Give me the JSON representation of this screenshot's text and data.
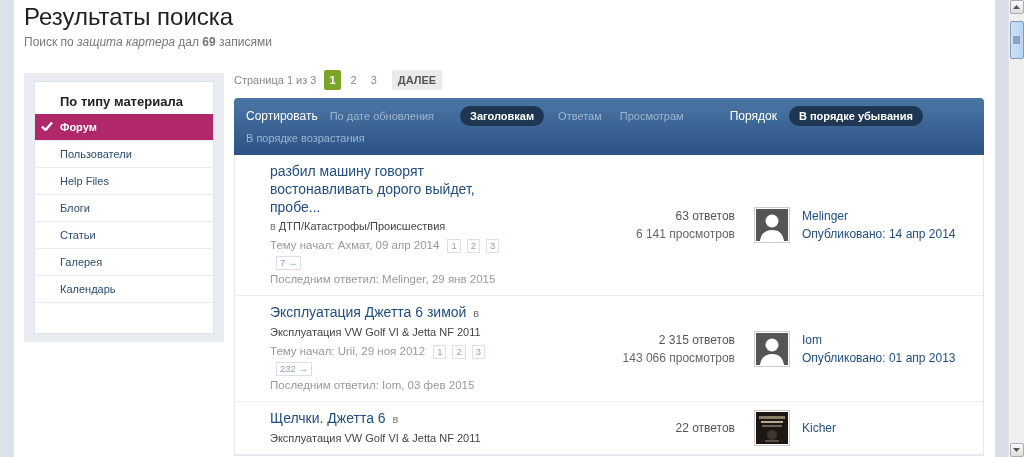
{
  "page": {
    "title": "Результаты поиска",
    "summary": "Поиск по *защита картера* дал **69** записями"
  },
  "sidebar": {
    "title": "По типу материала",
    "items": [
      {
        "label": "Форум",
        "selected": true
      },
      {
        "label": "Пользователи",
        "selected": false
      },
      {
        "label": "Help Files",
        "selected": false
      },
      {
        "label": "Блоги",
        "selected": false
      },
      {
        "label": "Статьи",
        "selected": false
      },
      {
        "label": "Галерея",
        "selected": false
      },
      {
        "label": "Календарь",
        "selected": false
      }
    ]
  },
  "pagination": {
    "label": "Страница 1 из 3",
    "pages": [
      {
        "label": "1",
        "selected": true
      },
      {
        "label": "2",
        "selected": false
      },
      {
        "label": "3",
        "selected": false
      }
    ],
    "next": "ДАЛЕЕ"
  },
  "sort_bar": {
    "label": "Сортировать",
    "options": [
      {
        "label": "По дате обновления",
        "selected": false
      },
      {
        "label": "Заголовкам",
        "selected": true
      },
      {
        "label": "Ответам",
        "selected": false
      },
      {
        "label": "Просмотрам",
        "selected": false
      }
    ],
    "order_label": "Порядок",
    "order_options": [
      {
        "label": "В порядке убывания",
        "selected": true
      },
      {
        "label": "В порядке возрастания",
        "selected": false
      }
    ]
  },
  "topics": [
    {
      "title": "разбил машину говорят востонавливать дорого выйдет, пробе...",
      "in": "в",
      "forum": "ДТП/Катастрофы/Происшествия",
      "started": "Тему начал: Ахмат, 09 апр 2014",
      "pages": [
        "1",
        "2",
        "3",
        "7 →"
      ],
      "last_reply": "Последним ответил: Melinger, 29 янв 2015",
      "replies": "63 ответов",
      "views": "6 141 просмотров",
      "avatar": {
        "kind": "silhouette"
      },
      "author": "Melinger",
      "published": "Опубликовано: 14 апр 2014"
    },
    {
      "title": "Эксплуатация Джетта 6 зимой",
      "in": "в",
      "forum": "Эксплуатация VW Golf VI & Jetta NF 2011",
      "started": "Тему начал: Urii, 29 ноя 2012",
      "pages": [
        "1",
        "2",
        "3",
        "232 →"
      ],
      "last_reply": "Последним ответил: Iom, 03 фев 2015",
      "replies": "2 315 ответов",
      "views": "143 066 просмотров",
      "avatar": {
        "kind": "silhouette"
      },
      "author": "Iom",
      "published": "Опубликовано: 01 апр 2013"
    },
    {
      "title": "Щелчки. Джетта 6",
      "in": "в",
      "forum": "Эксплуатация VW Golf VI & Jetta NF 2011",
      "replies": "22 ответов",
      "author": "Kicher"
    }
  ]
}
